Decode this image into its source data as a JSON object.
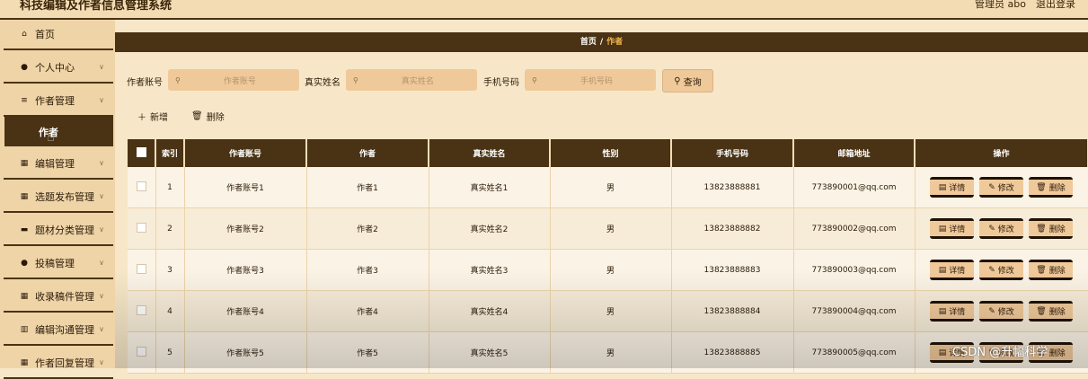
{
  "app": {
    "title": "科技编辑及作者信息管理系统",
    "admin": "管理员 abo",
    "logout": "退出登录"
  },
  "sidebar": {
    "items": [
      {
        "label": "首页",
        "icon": "home-icon",
        "glyph": "⌂"
      },
      {
        "label": "个人中心",
        "icon": "user-icon",
        "glyph": "●"
      },
      {
        "label": "作者管理",
        "icon": "list-icon",
        "glyph": "≡"
      },
      {
        "label": "编辑管理",
        "icon": "grid-icon",
        "glyph": "▦"
      },
      {
        "label": "选题发布管理",
        "icon": "grid-icon",
        "glyph": "▦"
      },
      {
        "label": "题材分类管理",
        "icon": "tag-icon",
        "glyph": "▬"
      },
      {
        "label": "投稿管理",
        "icon": "pin-icon",
        "glyph": "●"
      },
      {
        "label": "收录稿件管理",
        "icon": "grid-icon",
        "glyph": "▦"
      },
      {
        "label": "编辑沟通管理",
        "icon": "chart-icon",
        "glyph": "▥"
      },
      {
        "label": "作者回复管理",
        "icon": "grid-icon",
        "glyph": "▦"
      }
    ],
    "sub_active": "作者"
  },
  "breadcrumb": {
    "home": "首页",
    "sep": "/",
    "current": "作者"
  },
  "filters": {
    "account_label": "作者账号",
    "account_placeholder": "作者账号",
    "name_label": "真实姓名",
    "name_placeholder": "真实姓名",
    "phone_label": "手机号码",
    "phone_placeholder": "手机号码",
    "search_label": "查询"
  },
  "toolbar": {
    "add": "新增",
    "delete": "删除"
  },
  "table": {
    "headers": [
      "",
      "索引",
      "作者账号",
      "作者",
      "真实姓名",
      "性别",
      "手机号码",
      "邮箱地址",
      "操作"
    ],
    "rows": [
      {
        "idx": "1",
        "account": "作者账号1",
        "author": "作者1",
        "name": "真实姓名1",
        "gender": "男",
        "phone": "13823888881",
        "email": "773890001@qq.com"
      },
      {
        "idx": "2",
        "account": "作者账号2",
        "author": "作者2",
        "name": "真实姓名2",
        "gender": "男",
        "phone": "13823888882",
        "email": "773890002@qq.com"
      },
      {
        "idx": "3",
        "account": "作者账号3",
        "author": "作者3",
        "name": "真实姓名3",
        "gender": "男",
        "phone": "13823888883",
        "email": "773890003@qq.com"
      },
      {
        "idx": "4",
        "account": "作者账号4",
        "author": "作者4",
        "name": "真实姓名4",
        "gender": "男",
        "phone": "13823888884",
        "email": "773890004@qq.com"
      },
      {
        "idx": "5",
        "account": "作者账号5",
        "author": "作者5",
        "name": "真实姓名5",
        "gender": "男",
        "phone": "13823888885",
        "email": "773890005@qq.com"
      }
    ],
    "actions": {
      "detail": "详情",
      "edit": "修改",
      "delete": "删除"
    }
  },
  "watermark": "CSDN @升幅科学"
}
